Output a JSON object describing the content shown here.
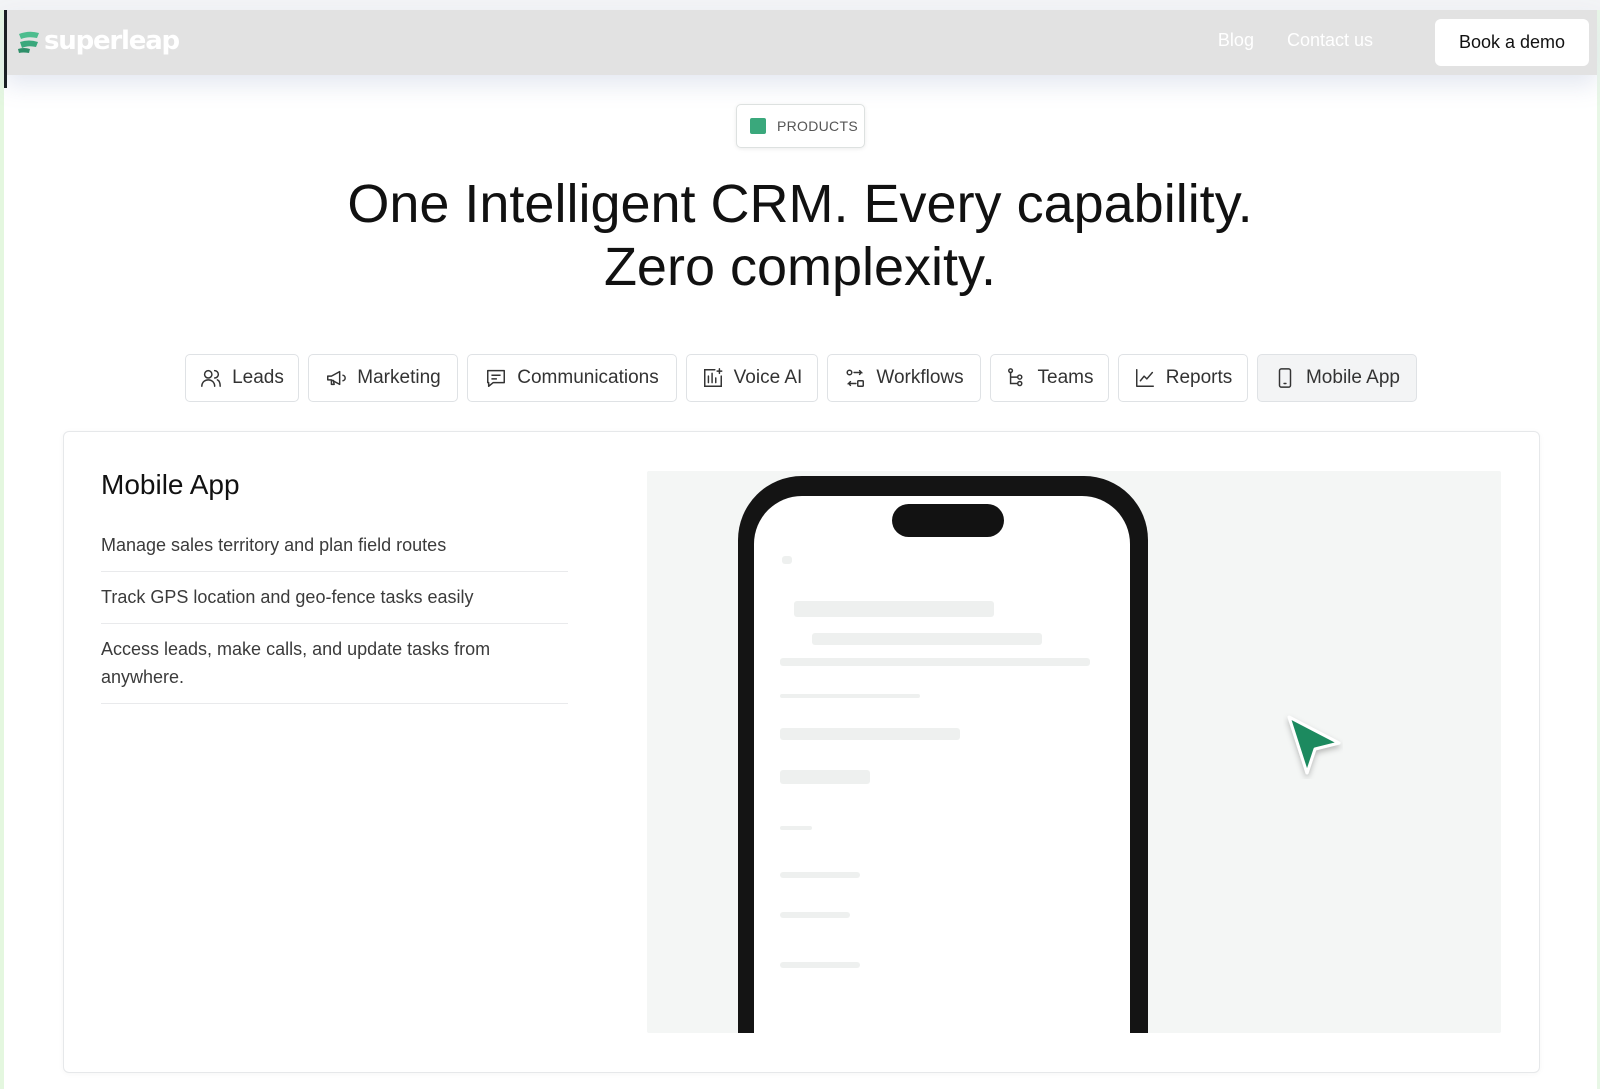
{
  "brand": {
    "name": "superleap",
    "accent": "#3aa87c"
  },
  "nav": {
    "links": [
      {
        "label": "Blog"
      },
      {
        "label": "Contact us"
      }
    ],
    "cta_label": "Book a demo"
  },
  "hero": {
    "badge": "PRODUCTS",
    "headline_line1": "One Intelligent CRM. Every capability.",
    "headline_line2": "Zero complexity."
  },
  "tabs": [
    {
      "label": "Leads",
      "icon": "users-icon",
      "active": false
    },
    {
      "label": "Marketing",
      "icon": "megaphone-icon",
      "active": false
    },
    {
      "label": "Communications",
      "icon": "message-icon",
      "active": false
    },
    {
      "label": "Voice AI",
      "icon": "voice-ai-icon",
      "active": false
    },
    {
      "label": "Workflows",
      "icon": "workflow-icon",
      "active": false
    },
    {
      "label": "Teams",
      "icon": "teams-icon",
      "active": false
    },
    {
      "label": "Reports",
      "icon": "chart-line-icon",
      "active": false
    },
    {
      "label": "Mobile App",
      "icon": "smartphone-icon",
      "active": true
    }
  ],
  "panel": {
    "title": "Mobile App",
    "features": [
      "Manage sales territory and plan field routes",
      "Track GPS location and geo-fence tasks easily",
      "Access leads, make calls, and update tasks from anywhere."
    ]
  }
}
